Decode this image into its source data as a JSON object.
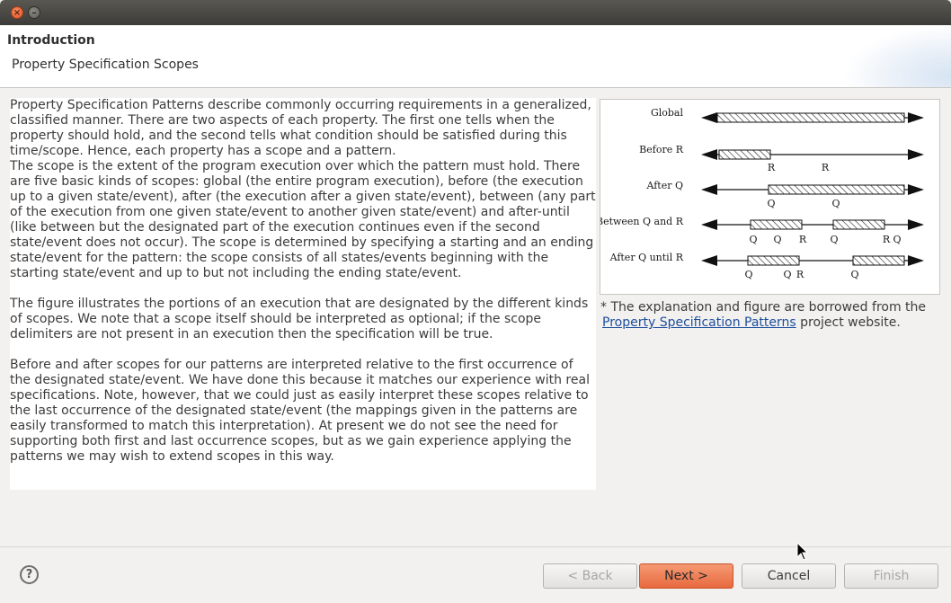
{
  "window": {
    "close_glyph": "×",
    "minimize_glyph": "–"
  },
  "header": {
    "title": "Introduction",
    "subtitle": "Property Specification Scopes"
  },
  "content": {
    "body": "Property Specification Patterns describe commonly occurring requirements in a generalized, classified manner. There are two aspects of each property. The first one tells when the property should hold, and the second tells what condition should be satisfied during this time/scope. Hence, each property has a scope and a pattern.\nThe scope is the extent of the program execution over which the pattern must hold. There are five basic kinds of scopes: global (the entire program execution), before (the execution up to a given state/event), after (the execution after a given state/event), between (any part of the execution from one given state/event to another given state/event) and after-until (like between but the designated part of the execution continues even if the second state/event does not occur). The scope is determined by specifying a starting and an ending state/event for the pattern: the scope consists of all states/events beginning with the starting state/event and up to but not including the ending state/event.\n\nThe figure illustrates the portions of an execution that are designated by the different kinds of scopes. We note that a scope itself should be interpreted as optional; if the scope delimiters are not present in an execution then the specification will be true.\n\nBefore and after scopes for our patterns are interpreted relative to the first occurrence of the designated state/event. We have done this because it matches our experience with real specifications. Note, however, that we could just as easily interpret these scopes relative to the last occurrence of the designated state/event (the mappings given in the patterns are easily transformed to match this interpretation). At present we do not see the need for supporting both first and last occurrence scopes, but as we gain experience applying the patterns we may wish to extend scopes in this way."
  },
  "figure": {
    "rows": [
      {
        "label": "Global"
      },
      {
        "label": "Before R",
        "marks": [
          "R",
          "R"
        ]
      },
      {
        "label": "After Q",
        "marks": [
          "Q",
          "Q"
        ]
      },
      {
        "label": "Between Q and R",
        "marks": [
          "Q",
          "Q",
          "R",
          "Q",
          "R",
          "Q"
        ]
      },
      {
        "label": "After Q until R",
        "marks": [
          "Q",
          "Q",
          "R",
          "Q"
        ]
      }
    ]
  },
  "note": {
    "prefix": "* The explanation and figure are borrowed from the",
    "link": "Property Specification Patterns",
    "suffix": " project website."
  },
  "footer": {
    "help_glyph": "?",
    "back": "< Back",
    "next": "Next >",
    "cancel": "Cancel",
    "finish": "Finish"
  },
  "colors": {
    "accent": "#e8693e",
    "link": "#1c4e9c"
  }
}
